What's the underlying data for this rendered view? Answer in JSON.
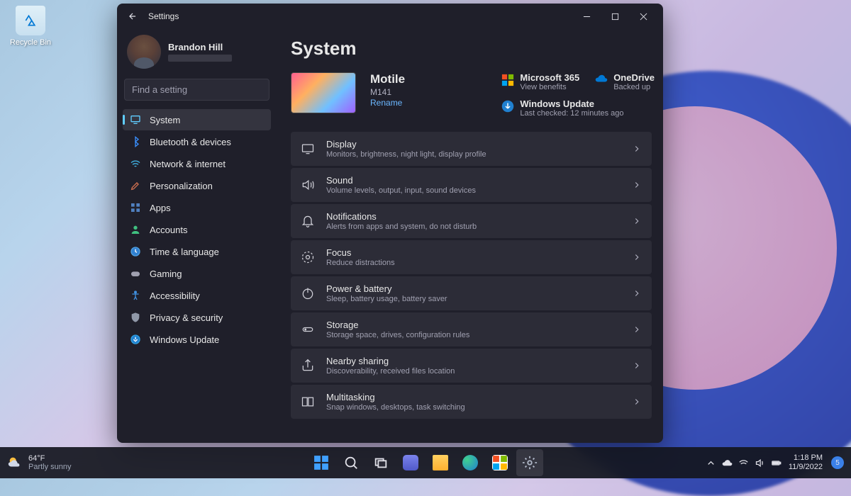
{
  "desktop": {
    "recycle_bin": "Recycle Bin"
  },
  "window": {
    "title": "Settings",
    "user": {
      "name": "Brandon Hill"
    },
    "search": {
      "placeholder": "Find a setting"
    },
    "nav": [
      {
        "label": "System"
      },
      {
        "label": "Bluetooth & devices"
      },
      {
        "label": "Network & internet"
      },
      {
        "label": "Personalization"
      },
      {
        "label": "Apps"
      },
      {
        "label": "Accounts"
      },
      {
        "label": "Time & language"
      },
      {
        "label": "Gaming"
      },
      {
        "label": "Accessibility"
      },
      {
        "label": "Privacy & security"
      },
      {
        "label": "Windows Update"
      }
    ],
    "main": {
      "title": "System",
      "device": {
        "name": "Motile",
        "model": "M141",
        "rename": "Rename"
      },
      "status": {
        "m365": {
          "title": "Microsoft 365",
          "sub": "View benefits"
        },
        "onedrive": {
          "title": "OneDrive",
          "sub": "Backed up"
        },
        "update": {
          "title": "Windows Update",
          "sub": "Last checked: 12 minutes ago"
        }
      },
      "rows": [
        {
          "title": "Display",
          "sub": "Monitors, brightness, night light, display profile"
        },
        {
          "title": "Sound",
          "sub": "Volume levels, output, input, sound devices"
        },
        {
          "title": "Notifications",
          "sub": "Alerts from apps and system, do not disturb"
        },
        {
          "title": "Focus",
          "sub": "Reduce distractions"
        },
        {
          "title": "Power & battery",
          "sub": "Sleep, battery usage, battery saver"
        },
        {
          "title": "Storage",
          "sub": "Storage space, drives, configuration rules"
        },
        {
          "title": "Nearby sharing",
          "sub": "Discoverability, received files location"
        },
        {
          "title": "Multitasking",
          "sub": "Snap windows, desktops, task switching"
        }
      ]
    }
  },
  "taskbar": {
    "weather": {
      "temp": "64°F",
      "desc": "Partly sunny"
    },
    "clock": {
      "time": "1:18 PM",
      "date": "11/9/2022"
    },
    "notif_count": "5"
  }
}
